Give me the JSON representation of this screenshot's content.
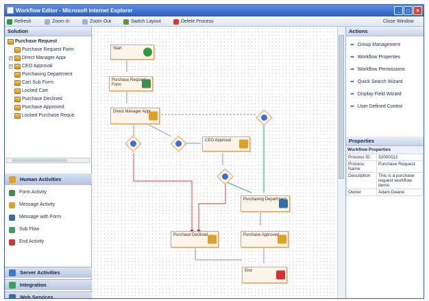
{
  "window": {
    "title": "Workflow Editor - Microsoft Internet Explorer",
    "icon": "ie-window-icon"
  },
  "toolbar": {
    "refresh": "Refresh",
    "zoom_in": "Zoom In",
    "zoom_out": "Zoom Out",
    "switch_layout": "Switch Layout",
    "delete_process": "Delete Process",
    "close_window": "Close Window"
  },
  "solution": {
    "title": "Solution",
    "root": "Purchase Request",
    "items": [
      {
        "label": "Purchase Request Form",
        "expander": ""
      },
      {
        "label": "Direct Manager Appr",
        "expander": "+"
      },
      {
        "label": "CEO Approval",
        "expander": "+"
      },
      {
        "label": "Purchasing Department",
        "expander": ""
      },
      {
        "label": "Cart Sub Form",
        "expander": ""
      },
      {
        "label": "Locked Cart",
        "expander": ""
      },
      {
        "label": "Purchase Declined",
        "expander": ""
      },
      {
        "label": "Purchase Approved",
        "expander": ""
      },
      {
        "label": "Locked Purchase Reque",
        "expander": ""
      }
    ]
  },
  "human_activities": {
    "title": "Human Activities",
    "items": [
      {
        "label": "Form Activity",
        "icon": "form-icon",
        "color": "#3f8f4f"
      },
      {
        "label": "Message Activity",
        "icon": "message-icon",
        "color": "#e0a020"
      },
      {
        "label": "Message with Form",
        "icon": "message-form-icon",
        "color": "#2f6fb0"
      },
      {
        "label": "Sub Flow",
        "icon": "subflow-icon",
        "color": "#3f9f5f"
      },
      {
        "label": "End Activity",
        "icon": "end-icon",
        "color": "#d83030"
      }
    ]
  },
  "bottom_panels": [
    {
      "label": "Server Activities",
      "icon": "server-icon",
      "color": "#3a78c8"
    },
    {
      "label": "Integration",
      "icon": "integration-icon",
      "color": "#3f9f5f"
    },
    {
      "label": "Web Services",
      "icon": "webservice-icon",
      "color": "#2f6fb0"
    }
  ],
  "actions": {
    "title": "Actions",
    "items": [
      "Group Management",
      "Workflow Properties",
      "Workflow Permissions",
      "Quick Search Wizard",
      "Display Field Wizard",
      "User Defined Control"
    ]
  },
  "properties": {
    "title": "Properties",
    "subtitle": "Workflow Properties",
    "rows": [
      {
        "key": "Process ID",
        "value": "32000112"
      },
      {
        "key": "Process Name",
        "value": "Purchase Request"
      },
      {
        "key": "Description",
        "value": "This is a purchase request workflow demo"
      },
      {
        "key": "Owner",
        "value": "Adam Deane"
      }
    ]
  },
  "diagram": {
    "nodes": {
      "start": "Start",
      "purchase_request_form": "Purchase Request Form",
      "direct_manager_appr": "Direct Manager Appr",
      "ceo_approval": "CEO Approval",
      "purchasing_department": "Purchasing Department",
      "purchase_declined": "Purchase Declined",
      "purchase_approved": "Purchase Approved",
      "end": "End"
    },
    "colors": {
      "decline_path": "#e86050",
      "approve_path": "#3ab06a",
      "flow": "#9aa6b8"
    }
  }
}
